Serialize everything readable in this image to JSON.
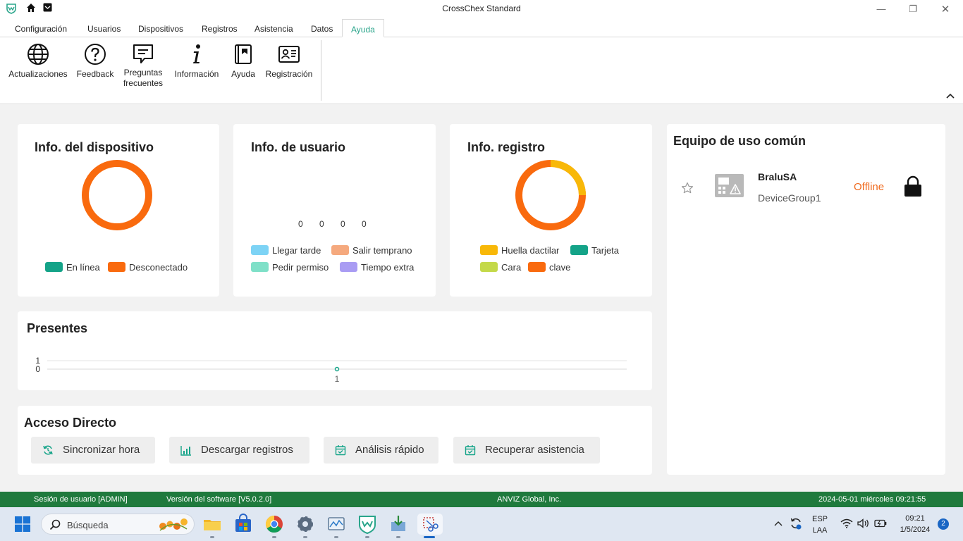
{
  "window": {
    "title": "CrossChex Standard",
    "minimize": "—",
    "maximize": "❐",
    "close": "✕"
  },
  "menu": {
    "tabs": [
      "Configuración",
      "Usuarios",
      "Dispositivos",
      "Registros",
      "Asistencia",
      "Datos",
      "Ayuda"
    ],
    "active": "Ayuda"
  },
  "ribbon": {
    "items": [
      {
        "label": "Actualizaciones",
        "icon": "globe-icon"
      },
      {
        "label": "Feedback",
        "icon": "question-icon"
      },
      {
        "label": "Preguntas frecuentes",
        "icon": "faq-icon"
      },
      {
        "label": "Información",
        "icon": "info-icon"
      },
      {
        "label": "Ayuda",
        "icon": "book-icon"
      },
      {
        "label": "Registración",
        "icon": "id-card-icon"
      }
    ]
  },
  "device_info": {
    "title": "Info. del dispositivo",
    "legend": [
      {
        "label": "En línea",
        "color": "#14a388"
      },
      {
        "label": "Desconectado",
        "color": "#f96a0e"
      }
    ]
  },
  "user_info": {
    "title": "Info. de usuario",
    "values": [
      "0",
      "0",
      "0",
      "0"
    ],
    "legend": [
      {
        "label": "Llegar tarde",
        "color": "#7dd3f5"
      },
      {
        "label": "Salir temprano",
        "color": "#f5a97e"
      },
      {
        "label": "Pedir permiso",
        "color": "#7fe0c8"
      },
      {
        "label": "Tiempo extra",
        "color": "#a99cf3"
      }
    ]
  },
  "record_info": {
    "title": "Info. registro",
    "legend": [
      {
        "label": "Huella dactilar",
        "color": "#f8b808"
      },
      {
        "label": "Tarjeta",
        "color": "#14a388"
      },
      {
        "label": "Cara",
        "color": "#c4d94a"
      },
      {
        "label": "clave",
        "color": "#f96a0e"
      }
    ]
  },
  "presentes": {
    "title": "Presentes",
    "y_ticks": [
      "1",
      "0"
    ],
    "x_ticks": [
      "1"
    ]
  },
  "chart_data": {
    "type": "line",
    "title": "Presentes",
    "x": [
      1
    ],
    "values": [
      0
    ],
    "ylim": [
      0,
      1
    ]
  },
  "direct_access": {
    "title": "Acceso Directo",
    "buttons": [
      {
        "label": "Sincronizar hora",
        "icon": "sync-icon"
      },
      {
        "label": "Descargar registros",
        "icon": "bar-chart-icon"
      },
      {
        "label": "Análisis rápido",
        "icon": "calendar-check-icon"
      },
      {
        "label": "Recuperar asistencia",
        "icon": "calendar-check-icon"
      }
    ]
  },
  "common_devices": {
    "title": "Equipo de uso común",
    "device": {
      "name": "BraluSA",
      "group": "DeviceGroup1",
      "status": "Offline"
    }
  },
  "statusbar": {
    "session": "Sesión de usuario  [ADMIN]",
    "version": "Versión del software  [V5.0.2.0]",
    "company": "ANVIZ Global, Inc.",
    "datetime": "2024-05-01 miércoles 09:21:55"
  },
  "taskbar": {
    "search_placeholder": "Búsqueda",
    "lang_top": "ESP",
    "lang_bottom": "LAA",
    "time": "09:21",
    "date": "1/5/2024",
    "notifications": "2"
  },
  "colors": {
    "accent": "#2aa58b",
    "status_bar": "#1f7a3d",
    "offline": "#f0691c",
    "ring_orange": "#f96a0e",
    "ring_yellow": "#f8b808"
  }
}
